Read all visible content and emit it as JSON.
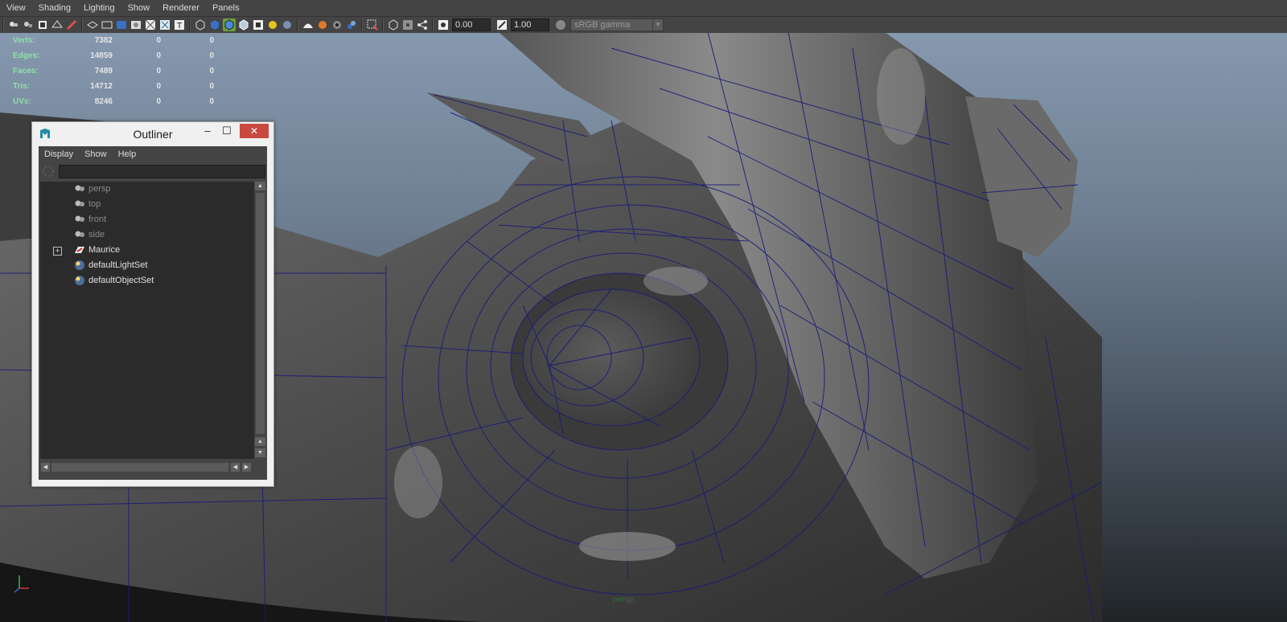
{
  "menubar": {
    "items": [
      {
        "label": "View"
      },
      {
        "label": "Shading"
      },
      {
        "label": "Lighting"
      },
      {
        "label": "Show"
      },
      {
        "label": "Renderer"
      },
      {
        "label": "Panels"
      }
    ]
  },
  "toolbar": {
    "exposure_value": "0.00",
    "gamma_value": "1.00",
    "colorspace": "sRGB gamma",
    "icons": [
      "camera-select-icon",
      "camera-attributes-icon",
      "bookmark-icon",
      "image-plane-icon",
      "grease-pencil-icon",
      "grid-icon",
      "film-gate-icon",
      "resolution-gate-icon",
      "gate-mask-icon",
      "field-chart-icon",
      "safe-action-icon",
      "safe-title-icon",
      "wireframe-icon",
      "smooth-shade-icon",
      "wireframe-on-shaded-icon",
      "textured-icon",
      "use-all-lights-icon",
      "shadows-icon",
      "screen-space-ao-icon",
      "motion-blur-icon",
      "multisample-aa-icon",
      "depth-of-field-icon",
      "isolate-select-icon",
      "xray-icon",
      "xray-active-components-icon",
      "xray-joints-icon",
      "exposure-icon",
      "gamma-icon",
      "color-management-icon"
    ]
  },
  "hud": {
    "rows": [
      {
        "label": "Verts:",
        "value": "7382",
        "a": "0",
        "b": "0"
      },
      {
        "label": "Edges:",
        "value": "14859",
        "a": "0",
        "b": "0"
      },
      {
        "label": "Faces:",
        "value": "7489",
        "a": "0",
        "b": "0"
      },
      {
        "label": "Tris:",
        "value": "14712",
        "a": "0",
        "b": "0"
      },
      {
        "label": "UVs:",
        "value": "8246",
        "a": "0",
        "b": "0"
      }
    ]
  },
  "outliner": {
    "title": "Outliner",
    "menu": [
      "Display",
      "Show",
      "Help"
    ],
    "filter_placeholder": "",
    "items": [
      {
        "label": "persp",
        "icon": "camera-icon",
        "dim": true
      },
      {
        "label": "top",
        "icon": "camera-icon",
        "dim": true
      },
      {
        "label": "front",
        "icon": "camera-icon",
        "dim": true
      },
      {
        "label": "side",
        "icon": "camera-icon",
        "dim": true
      },
      {
        "label": "Maurice",
        "icon": "mesh-icon",
        "dim": false,
        "expandable": true
      },
      {
        "label": "defaultLightSet",
        "icon": "set-icon",
        "dim": false
      },
      {
        "label": "defaultObjectSet",
        "icon": "set-icon",
        "dim": false
      }
    ]
  },
  "viewport": {
    "camera": "persp"
  },
  "colors": {
    "ui_bg": "#444444",
    "hud_label": "#8ee0a6",
    "active_toggle": "#6c9f3a",
    "wire": "#1a1a7a",
    "close_button": "#c84a3f"
  }
}
